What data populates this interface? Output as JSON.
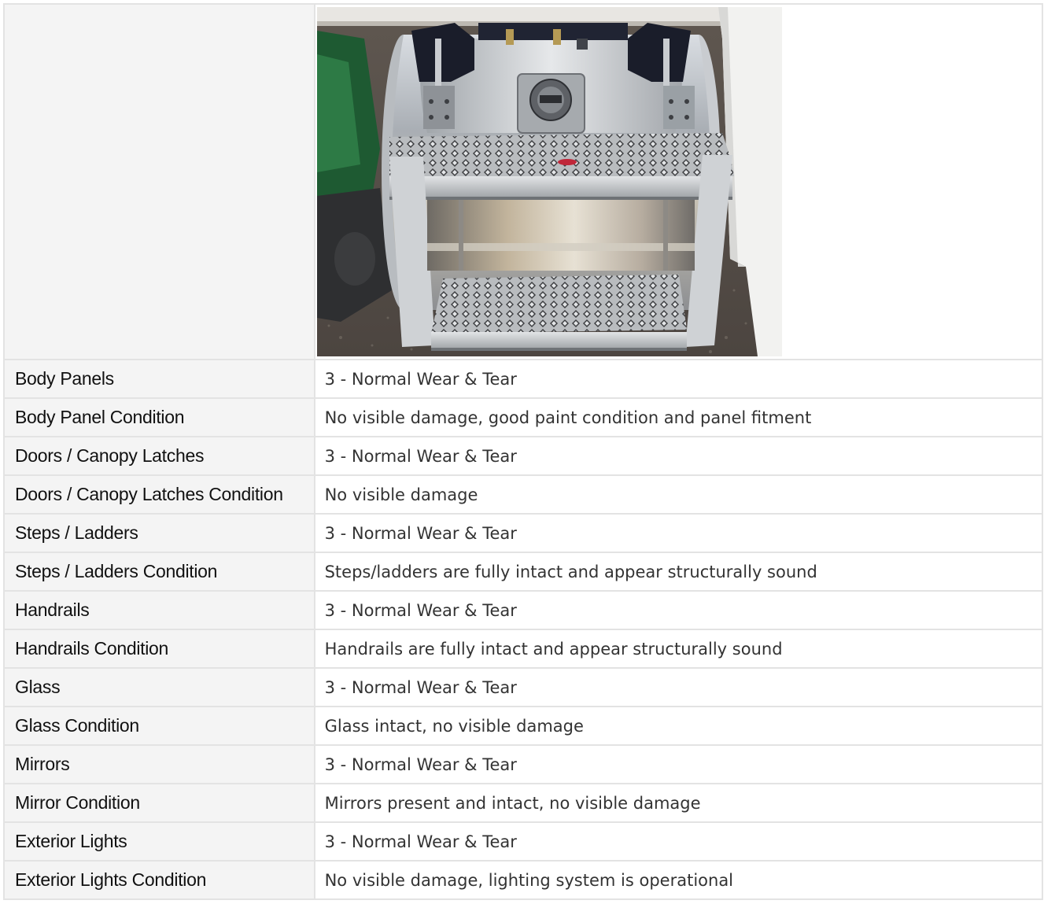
{
  "photo": {
    "icon": "fuel-tank-photo"
  },
  "rows": [
    {
      "label": "Body Panels",
      "value": "3 - Normal Wear & Tear"
    },
    {
      "label": "Body Panel Condition",
      "value": "No visible damage, good paint condition and panel fitment"
    },
    {
      "label": "Doors / Canopy Latches",
      "value": "3 - Normal Wear & Tear"
    },
    {
      "label": "Doors / Canopy Latches Condition",
      "value": "No visible damage"
    },
    {
      "label": "Steps / Ladders",
      "value": "3 - Normal Wear & Tear"
    },
    {
      "label": "Steps / Ladders Condition",
      "value": "Steps/ladders are fully intact and appear structurally sound"
    },
    {
      "label": "Handrails",
      "value": "3 - Normal Wear & Tear"
    },
    {
      "label": "Handrails Condition",
      "value": "Handrails are fully intact and appear structurally sound"
    },
    {
      "label": "Glass",
      "value": "3 - Normal Wear & Tear"
    },
    {
      "label": "Glass Condition",
      "value": "Glass intact, no visible damage"
    },
    {
      "label": "Mirrors",
      "value": "3 - Normal Wear & Tear"
    },
    {
      "label": "Mirror Condition",
      "value": "Mirrors present and intact, no visible damage"
    },
    {
      "label": "Exterior Lights",
      "value": "3 - Normal Wear & Tear"
    },
    {
      "label": "Exterior Lights Condition",
      "value": "No visible damage, lighting system is operational"
    }
  ]
}
